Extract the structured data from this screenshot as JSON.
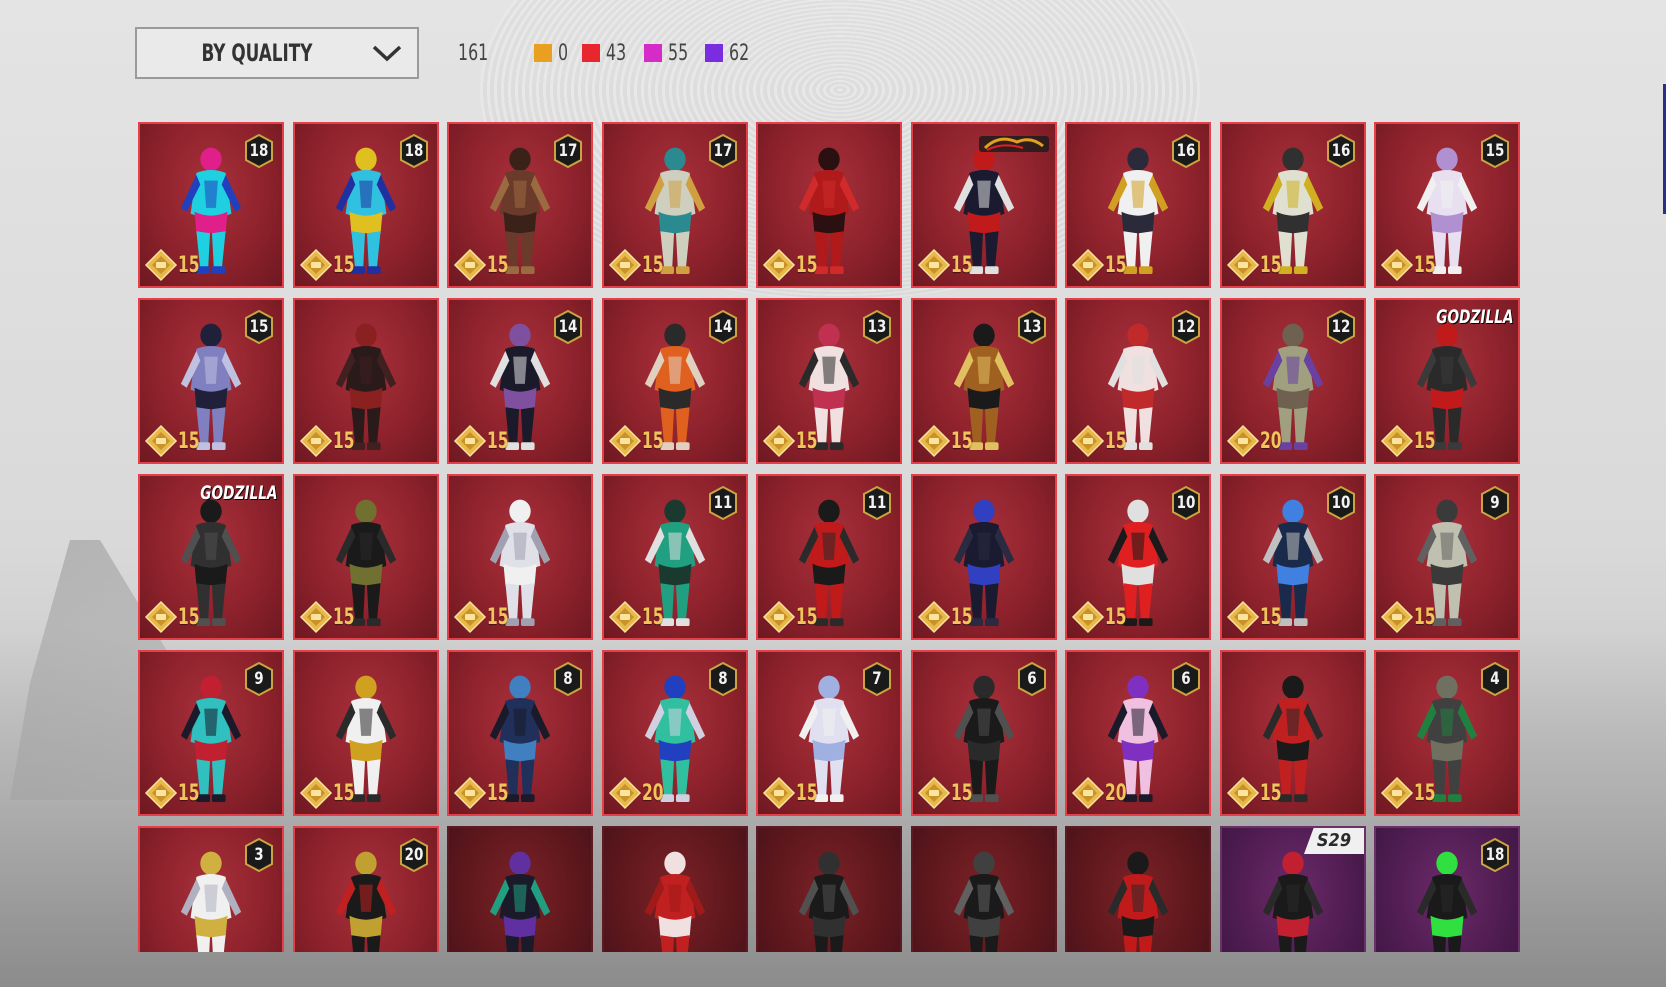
{
  "filter": {
    "sort_label": "BY QUALITY",
    "chevron_icon": "chevron-down-icon"
  },
  "stats": {
    "total": "161",
    "qualities": [
      {
        "color": "#e9a020",
        "count": "0"
      },
      {
        "color": "#e8262e",
        "count": "43"
      },
      {
        "color": "#d52cc8",
        "count": "55"
      },
      {
        "color": "#7a2ce0",
        "count": "62"
      }
    ]
  },
  "items": [
    {
      "count": "18",
      "cost": "15",
      "palette": [
        "#1fd0e0",
        "#e01f8a",
        "#2040c0"
      ]
    },
    {
      "count": "18",
      "cost": "15",
      "palette": [
        "#30c0e0",
        "#e0c020",
        "#2030a0"
      ]
    },
    {
      "count": "17",
      "cost": "15",
      "palette": [
        "#6a3a2a",
        "#3a2218",
        "#9a6a40"
      ]
    },
    {
      "count": "17",
      "cost": "15",
      "palette": [
        "#cfcfc0",
        "#2a8a90",
        "#d0a040"
      ]
    },
    {
      "count": "",
      "cost": "15",
      "palette": [
        "#b01a1a",
        "#2a1010",
        "#d02a2a"
      ]
    },
    {
      "count": "",
      "cost": "15",
      "logo": "The King of Fighters",
      "palette": [
        "#1a1a30",
        "#c01a1a",
        "#e0e0e0"
      ]
    },
    {
      "count": "16",
      "cost": "15",
      "palette": [
        "#f0f0f0",
        "#2a2a3a",
        "#d0a020"
      ]
    },
    {
      "count": "16",
      "cost": "15",
      "palette": [
        "#e0e0d0",
        "#303030",
        "#d0b020"
      ]
    },
    {
      "count": "15",
      "cost": "15",
      "palette": [
        "#e8e0f0",
        "#b090d0",
        "#f0f0f0"
      ]
    },
    {
      "count": "15",
      "cost": "15",
      "palette": [
        "#8080c0",
        "#20203a",
        "#c0c0e0"
      ]
    },
    {
      "count": "",
      "cost": "15",
      "palette": [
        "#2a1a1a",
        "#8a2020",
        "#402020"
      ]
    },
    {
      "count": "14",
      "cost": "15",
      "palette": [
        "#1a1a2a",
        "#8050a0",
        "#e0e0e0"
      ]
    },
    {
      "count": "14",
      "cost": "15",
      "palette": [
        "#e06020",
        "#2a2a2a",
        "#e0d0c0"
      ]
    },
    {
      "count": "13",
      "cost": "15",
      "palette": [
        "#f0e0e0",
        "#c03050",
        "#2a2a2a"
      ]
    },
    {
      "count": "13",
      "cost": "15",
      "palette": [
        "#a06020",
        "#1a1a1a",
        "#e0c060"
      ]
    },
    {
      "count": "12",
      "cost": "15",
      "palette": [
        "#f0e0e0",
        "#c02a2a",
        "#e0e0e0"
      ]
    },
    {
      "count": "12",
      "cost": "20",
      "palette": [
        "#a0a080",
        "#706050",
        "#6a40a0"
      ]
    },
    {
      "count": "",
      "cost": "15",
      "logo": "GODZILLA",
      "palette": [
        "#2a2a2a",
        "#c01a1a",
        "#3a3a3a"
      ]
    },
    {
      "count": "",
      "cost": "15",
      "logo": "GODZILLA",
      "palette": [
        "#303030",
        "#1a1a1a",
        "#505050"
      ]
    },
    {
      "count": "",
      "cost": "15",
      "palette": [
        "#1a1a1a",
        "#707030",
        "#2a2a2a"
      ]
    },
    {
      "count": "",
      "cost": "15",
      "palette": [
        "#e0e0e8",
        "#f0f0f0",
        "#a0a0b0"
      ]
    },
    {
      "count": "11",
      "cost": "15",
      "palette": [
        "#20a080",
        "#1a3a30",
        "#e0e0e0"
      ]
    },
    {
      "count": "11",
      "cost": "15",
      "palette": [
        "#c01a1a",
        "#1a1a1a",
        "#2a2a2a"
      ]
    },
    {
      "count": "",
      "cost": "15",
      "palette": [
        "#1a1a30",
        "#3040c0",
        "#2a2a40"
      ]
    },
    {
      "count": "10",
      "cost": "15",
      "palette": [
        "#e02020",
        "#e0e0e0",
        "#1a1a1a"
      ]
    },
    {
      "count": "10",
      "cost": "15",
      "palette": [
        "#1a2a4a",
        "#4080e0",
        "#c0c0c0"
      ]
    },
    {
      "count": "9",
      "cost": "15",
      "palette": [
        "#c0c0b0",
        "#3a3a3a",
        "#606060"
      ]
    },
    {
      "count": "9",
      "cost": "15",
      "palette": [
        "#30c0c0",
        "#c02030",
        "#1a1a2a"
      ]
    },
    {
      "count": "",
      "cost": "15",
      "palette": [
        "#f0f0f0",
        "#d0a020",
        "#2a2a2a"
      ]
    },
    {
      "count": "8",
      "cost": "15",
      "palette": [
        "#20305a",
        "#4080c0",
        "#1a1a2a"
      ]
    },
    {
      "count": "8",
      "cost": "20",
      "palette": [
        "#30c0a0",
        "#2040c0",
        "#d0d0e0"
      ]
    },
    {
      "count": "7",
      "cost": "15",
      "palette": [
        "#e0e0f0",
        "#a0b0e0",
        "#f0f0f0"
      ]
    },
    {
      "count": "6",
      "cost": "15",
      "palette": [
        "#1a1a1a",
        "#2a2a2a",
        "#505050"
      ]
    },
    {
      "count": "6",
      "cost": "20",
      "palette": [
        "#f0c0e0",
        "#8030c0",
        "#1a1a2a"
      ]
    },
    {
      "count": "",
      "cost": "15",
      "palette": [
        "#c02020",
        "#1a1a1a",
        "#2a2a2a"
      ]
    },
    {
      "count": "4",
      "cost": "15",
      "palette": [
        "#404040",
        "#707060",
        "#208040"
      ]
    },
    {
      "count": "3",
      "cost": "",
      "palette": [
        "#f0f0f0",
        "#d0b040",
        "#b0b0c0"
      ]
    },
    {
      "count": "20",
      "cost": "",
      "palette": [
        "#1a1a1a",
        "#c0a030",
        "#c02020"
      ]
    },
    {
      "count": "",
      "cost": "",
      "variant": "dark",
      "palette": [
        "#1a1a2a",
        "#6030a0",
        "#20a080"
      ]
    },
    {
      "count": "",
      "cost": "",
      "variant": "dark",
      "palette": [
        "#c02020",
        "#f0e0e0",
        "#a01a1a"
      ]
    },
    {
      "count": "",
      "cost": "",
      "variant": "dark",
      "palette": [
        "#1a1a1a",
        "#303030",
        "#505050"
      ]
    },
    {
      "count": "",
      "cost": "",
      "variant": "dark",
      "palette": [
        "#1a1a1a",
        "#404040",
        "#606060"
      ]
    },
    {
      "count": "",
      "cost": "",
      "variant": "dark",
      "palette": [
        "#c01a1a",
        "#1a1a1a",
        "#2a2a2a"
      ]
    },
    {
      "count": "",
      "cost": "",
      "variant": "purple",
      "season": "S29",
      "palette": [
        "#1a1a1a",
        "#c02030",
        "#2a2a2a"
      ]
    },
    {
      "count": "18",
      "cost": "",
      "variant": "purple",
      "palette": [
        "#1a1a1a",
        "#30e040",
        "#2a2a2a"
      ]
    }
  ]
}
